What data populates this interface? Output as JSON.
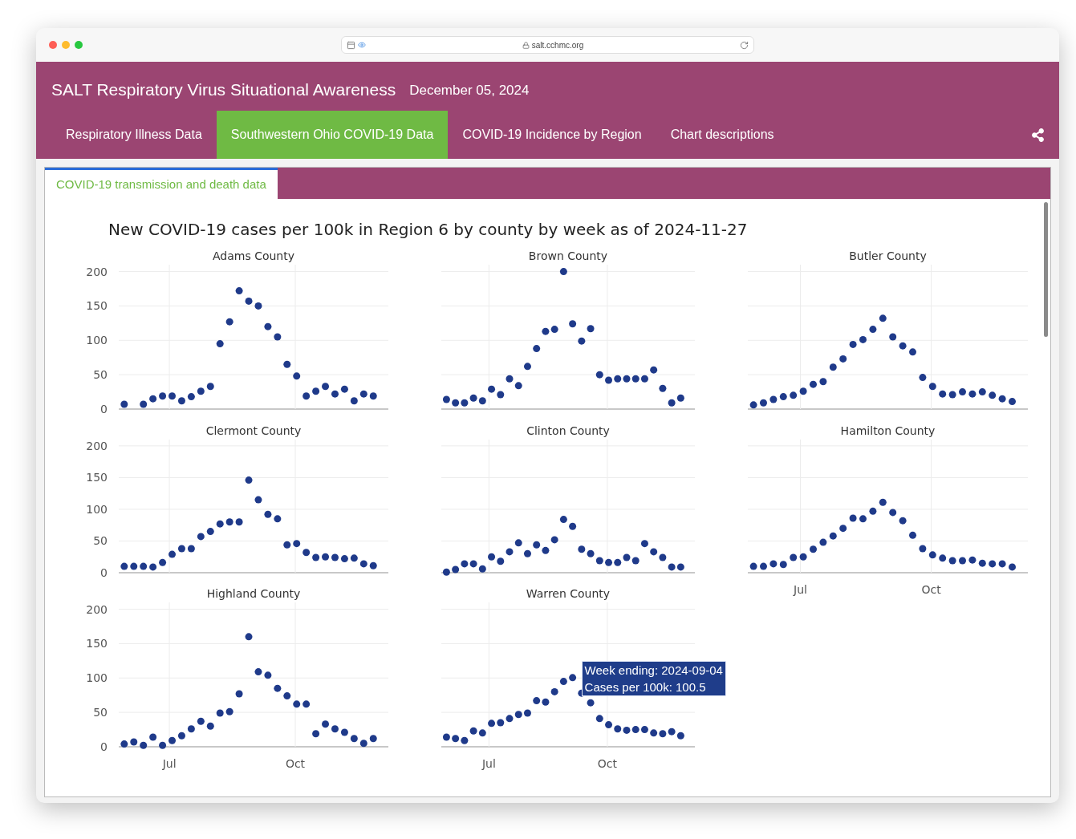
{
  "browser": {
    "url": "salt.cchmc.org"
  },
  "header": {
    "title": "SALT Respiratory Virus Situational Awareness",
    "date": "December 05, 2024"
  },
  "nav_tabs": [
    {
      "label": "Respiratory Illness Data",
      "selected": false
    },
    {
      "label": "Southwestern Ohio COVID-19 Data",
      "selected": true
    },
    {
      "label": "COVID-19 Incidence by Region",
      "selected": false
    },
    {
      "label": "Chart descriptions",
      "selected": false
    }
  ],
  "sub_tabs": [
    {
      "label": "COVID-19 transmission and death data",
      "selected": true
    }
  ],
  "figure": {
    "title": "New COVID-19 cases per 100k in Region 6 by county by week as of 2024-11-27",
    "panels": [
      {
        "chart_data": {
          "type": "scatter",
          "title": "Adams County",
          "grid": true,
          "x": [
            "2024-05-29",
            "2024-06-05",
            "2024-06-12",
            "2024-06-19",
            "2024-06-26",
            "2024-07-03",
            "2024-07-10",
            "2024-07-17",
            "2024-07-24",
            "2024-07-31",
            "2024-08-07",
            "2024-08-14",
            "2024-08-21",
            "2024-08-28",
            "2024-09-04",
            "2024-09-11",
            "2024-09-18",
            "2024-09-25",
            "2024-10-02",
            "2024-10-09",
            "2024-10-16",
            "2024-10-23",
            "2024-10-30",
            "2024-11-06",
            "2024-11-13",
            "2024-11-20",
            "2024-11-27"
          ],
          "series": [
            {
              "color": "#1f3a8a",
              "values": [
                7,
                null,
                7,
                15,
                19,
                19,
                12,
                18,
                26,
                33,
                95,
                127,
                172,
                157,
                150,
                120,
                105,
                65,
                48,
                19,
                26,
                33,
                22,
                29,
                12,
                22,
                19
              ]
            }
          ],
          "xlim": [
            "2024-05-25",
            "2024-12-08"
          ],
          "ylim": [
            0,
            210
          ],
          "yticks": [
            0,
            50,
            100,
            150,
            200
          ]
        }
      },
      {
        "chart_data": {
          "type": "scatter",
          "title": "Brown County",
          "grid": true,
          "x": [
            "2024-05-29",
            "2024-06-05",
            "2024-06-12",
            "2024-06-19",
            "2024-06-26",
            "2024-07-03",
            "2024-07-10",
            "2024-07-17",
            "2024-07-24",
            "2024-07-31",
            "2024-08-07",
            "2024-08-14",
            "2024-08-21",
            "2024-08-28",
            "2024-09-04",
            "2024-09-11",
            "2024-09-18",
            "2024-09-25",
            "2024-10-02",
            "2024-10-09",
            "2024-10-16",
            "2024-10-23",
            "2024-10-30",
            "2024-11-06",
            "2024-11-13",
            "2024-11-20",
            "2024-11-27"
          ],
          "series": [
            {
              "color": "#1f3a8a",
              "values": [
                14,
                9,
                9,
                16,
                12,
                29,
                21,
                44,
                34,
                62,
                88,
                113,
                116,
                200,
                124,
                99,
                117,
                50,
                42,
                44,
                44,
                44,
                44,
                57,
                30,
                9,
                16
              ]
            }
          ],
          "xlim": [
            "2024-05-25",
            "2024-12-08"
          ],
          "ylim": [
            0,
            210
          ]
        }
      },
      {
        "chart_data": {
          "type": "scatter",
          "title": "Butler County",
          "grid": true,
          "x": [
            "2024-05-29",
            "2024-06-05",
            "2024-06-12",
            "2024-06-19",
            "2024-06-26",
            "2024-07-03",
            "2024-07-10",
            "2024-07-17",
            "2024-07-24",
            "2024-07-31",
            "2024-08-07",
            "2024-08-14",
            "2024-08-21",
            "2024-08-28",
            "2024-09-04",
            "2024-09-11",
            "2024-09-18",
            "2024-09-25",
            "2024-10-02",
            "2024-10-09",
            "2024-10-16",
            "2024-10-23",
            "2024-10-30",
            "2024-11-06",
            "2024-11-13",
            "2024-11-20",
            "2024-11-27"
          ],
          "series": [
            {
              "color": "#1f3a8a",
              "values": [
                6,
                9,
                14,
                18,
                20,
                26,
                36,
                40,
                61,
                73,
                94,
                101,
                116,
                132,
                105,
                92,
                83,
                46,
                33,
                22,
                21,
                25,
                22,
                25,
                20,
                15,
                11
              ]
            }
          ],
          "xlim": [
            "2024-05-25",
            "2024-12-08"
          ],
          "ylim": [
            0,
            210
          ]
        }
      },
      {
        "chart_data": {
          "type": "scatter",
          "title": "Clermont County",
          "grid": true,
          "x": [
            "2024-05-29",
            "2024-06-05",
            "2024-06-12",
            "2024-06-19",
            "2024-06-26",
            "2024-07-03",
            "2024-07-10",
            "2024-07-17",
            "2024-07-24",
            "2024-07-31",
            "2024-08-07",
            "2024-08-14",
            "2024-08-21",
            "2024-08-28",
            "2024-09-04",
            "2024-09-11",
            "2024-09-18",
            "2024-09-25",
            "2024-10-02",
            "2024-10-09",
            "2024-10-16",
            "2024-10-23",
            "2024-10-30",
            "2024-11-06",
            "2024-11-13",
            "2024-11-20",
            "2024-11-27"
          ],
          "series": [
            {
              "color": "#1f3a8a",
              "values": [
                10,
                10,
                10,
                9,
                16,
                29,
                38,
                38,
                57,
                65,
                77,
                80,
                80,
                146,
                115,
                92,
                85,
                44,
                46,
                32,
                24,
                25,
                24,
                22,
                23,
                14,
                11
              ]
            }
          ],
          "xlim": [
            "2024-05-25",
            "2024-12-08"
          ],
          "ylim": [
            0,
            210
          ],
          "yticks": [
            0,
            50,
            100,
            150,
            200
          ]
        }
      },
      {
        "chart_data": {
          "type": "scatter",
          "title": "Clinton County",
          "grid": true,
          "x": [
            "2024-05-29",
            "2024-06-05",
            "2024-06-12",
            "2024-06-19",
            "2024-06-26",
            "2024-07-03",
            "2024-07-10",
            "2024-07-17",
            "2024-07-24",
            "2024-07-31",
            "2024-08-07",
            "2024-08-14",
            "2024-08-21",
            "2024-08-28",
            "2024-09-04",
            "2024-09-11",
            "2024-09-18",
            "2024-09-25",
            "2024-10-02",
            "2024-10-09",
            "2024-10-16",
            "2024-10-23",
            "2024-10-30",
            "2024-11-06",
            "2024-11-13",
            "2024-11-20",
            "2024-11-27"
          ],
          "series": [
            {
              "color": "#1f3a8a",
              "values": [
                1,
                5,
                14,
                14,
                6,
                25,
                18,
                33,
                47,
                30,
                44,
                35,
                52,
                84,
                73,
                37,
                30,
                19,
                16,
                16,
                24,
                19,
                46,
                33,
                24,
                9,
                9
              ]
            }
          ],
          "xlim": [
            "2024-05-25",
            "2024-12-08"
          ],
          "ylim": [
            0,
            210
          ]
        }
      },
      {
        "chart_data": {
          "type": "scatter",
          "title": "Hamilton County",
          "grid": true,
          "x": [
            "2024-05-29",
            "2024-06-05",
            "2024-06-12",
            "2024-06-19",
            "2024-06-26",
            "2024-07-03",
            "2024-07-10",
            "2024-07-17",
            "2024-07-24",
            "2024-07-31",
            "2024-08-07",
            "2024-08-14",
            "2024-08-21",
            "2024-08-28",
            "2024-09-04",
            "2024-09-11",
            "2024-09-18",
            "2024-09-25",
            "2024-10-02",
            "2024-10-09",
            "2024-10-16",
            "2024-10-23",
            "2024-10-30",
            "2024-11-06",
            "2024-11-13",
            "2024-11-20",
            "2024-11-27"
          ],
          "series": [
            {
              "color": "#1f3a8a",
              "values": [
                10,
                10,
                14,
                13,
                24,
                25,
                37,
                48,
                58,
                70,
                86,
                85,
                97,
                111,
                95,
                82,
                59,
                38,
                28,
                23,
                19,
                19,
                20,
                15,
                14,
                14,
                9
              ]
            }
          ],
          "xlim": [
            "2024-05-25",
            "2024-12-08"
          ],
          "ylim": [
            0,
            210
          ],
          "xticks": [
            {
              "value": "2024-07-01",
              "label": "Jul"
            },
            {
              "value": "2024-10-01",
              "label": "Oct"
            }
          ]
        }
      },
      {
        "chart_data": {
          "type": "scatter",
          "title": "Highland County",
          "grid": true,
          "x": [
            "2024-05-29",
            "2024-06-05",
            "2024-06-12",
            "2024-06-19",
            "2024-06-26",
            "2024-07-03",
            "2024-07-10",
            "2024-07-17",
            "2024-07-24",
            "2024-07-31",
            "2024-08-07",
            "2024-08-14",
            "2024-08-21",
            "2024-08-28",
            "2024-09-04",
            "2024-09-11",
            "2024-09-18",
            "2024-09-25",
            "2024-10-02",
            "2024-10-09",
            "2024-10-16",
            "2024-10-23",
            "2024-10-30",
            "2024-11-06",
            "2024-11-13",
            "2024-11-20",
            "2024-11-27"
          ],
          "series": [
            {
              "color": "#1f3a8a",
              "values": [
                4,
                7,
                2,
                14,
                2,
                9,
                16,
                26,
                37,
                30,
                49,
                51,
                77,
                160,
                109,
                104,
                85,
                74,
                62,
                62,
                19,
                33,
                26,
                21,
                12,
                5,
                12
              ]
            }
          ],
          "xlim": [
            "2024-05-25",
            "2024-12-08"
          ],
          "ylim": [
            0,
            210
          ],
          "xticks": [
            {
              "value": "2024-07-01",
              "label": "Jul"
            },
            {
              "value": "2024-10-01",
              "label": "Oct"
            }
          ],
          "yticks": [
            0,
            50,
            100,
            150,
            200
          ]
        }
      },
      {
        "chart_data": {
          "type": "scatter",
          "title": "Warren County",
          "grid": true,
          "x": [
            "2024-05-29",
            "2024-06-05",
            "2024-06-12",
            "2024-06-19",
            "2024-06-26",
            "2024-07-03",
            "2024-07-10",
            "2024-07-17",
            "2024-07-24",
            "2024-07-31",
            "2024-08-07",
            "2024-08-14",
            "2024-08-21",
            "2024-08-28",
            "2024-09-04",
            "2024-09-11",
            "2024-09-18",
            "2024-09-25",
            "2024-10-02",
            "2024-10-09",
            "2024-10-16",
            "2024-10-23",
            "2024-10-30",
            "2024-11-06",
            "2024-11-13",
            "2024-11-20",
            "2024-11-27"
          ],
          "series": [
            {
              "color": "#1f3a8a",
              "values": [
                14,
                12,
                9,
                23,
                20,
                34,
                35,
                41,
                47,
                49,
                67,
                65,
                80,
                95,
                100.5,
                78,
                64,
                41,
                32,
                26,
                24,
                25,
                25,
                20,
                19,
                22,
                16
              ]
            }
          ],
          "xlim": [
            "2024-05-25",
            "2024-12-08"
          ],
          "ylim": [
            0,
            210
          ],
          "xticks": [
            {
              "value": "2024-07-01",
              "label": "Jul"
            },
            {
              "value": "2024-10-01",
              "label": "Oct"
            }
          ],
          "annotations": [
            {
              "x": "2024-09-04",
              "y": 100.5,
              "text": "Week ending: 2024-09-04\nCases per 100k: 100.5"
            }
          ]
        }
      }
    ]
  }
}
